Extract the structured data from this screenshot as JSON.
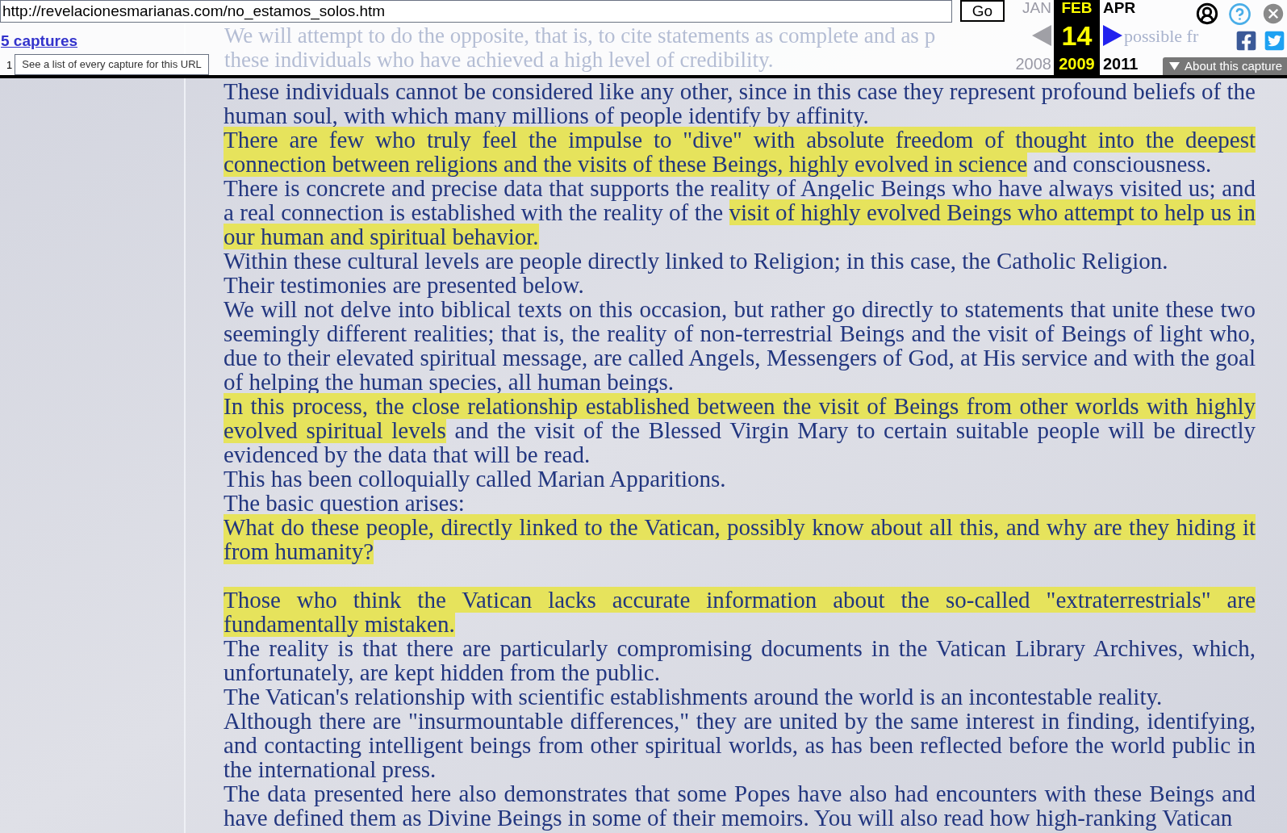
{
  "toolbar": {
    "url": "http://revelacionesmarianas.com/no_estamos_solos.htm",
    "go_button": "Go",
    "captures_link": "5 captures",
    "tooltip_prefix": "1",
    "tooltip": "See a list of every capture for this URL",
    "months": [
      {
        "month": "JAN",
        "year": "2008",
        "selected": false,
        "available": false
      },
      {
        "month": "FEB",
        "day": "14",
        "year": "2009",
        "selected": true
      },
      {
        "month": "APR",
        "year": "2011",
        "selected": false,
        "available": true
      }
    ],
    "about_button": "About this capture"
  },
  "page": {
    "faint_lines": [
      "We will attempt to do the opposite, that is, to cite statements as complete and as p",
      "these individuals who have achieved a high level of credibility."
    ],
    "faint_fragment": "possible fr",
    "paragraphs": [
      {
        "kind": "text",
        "segments": [
          {
            "text": "These individuals cannot be considered like any other, since in this case they represent profound beliefs of the human soul, with which many millions of people identify by affinity.",
            "highlighted": false
          }
        ]
      },
      {
        "kind": "text",
        "segments": [
          {
            "text": "There are few who truly feel the impulse to \"dive\" with absolute freedom of thought into the deepest connection between religions and the visits of these Beings, highly evolved in science",
            "highlighted": true
          },
          {
            "text": " and consciousness.",
            "highlighted": false
          }
        ]
      },
      {
        "kind": "text",
        "segments": [
          {
            "text": "There is concrete and precise data that supports the reality of Angelic Beings who have always visited us; and a real connection is established with the reality of the ",
            "highlighted": false
          },
          {
            "text": "visit of highly evolved Beings who attempt to help us in our human and spiritual behavior.",
            "highlighted": true
          }
        ]
      },
      {
        "kind": "text",
        "segments": [
          {
            "text": "Within these cultural levels are people directly linked to Religion; in this case, the Catholic Religion.",
            "highlighted": false
          }
        ]
      },
      {
        "kind": "text",
        "segments": [
          {
            "text": "Their testimonies are presented below.",
            "highlighted": false
          }
        ]
      },
      {
        "kind": "text",
        "segments": [
          {
            "text": "We will not delve into biblical texts on this occasion, but rather go directly to statements that unite these two seemingly different realities; that is, the reality of non-terrestrial Beings and the visit of Beings of light who, due to their elevated spiritual message, are called Angels, Messengers of God, at His service and with the goal of helping the human species, all human beings.",
            "highlighted": false
          }
        ]
      },
      {
        "kind": "text",
        "segments": [
          {
            "text": "In this process, the close relationship established between the visit of Beings from other worlds with highly evolved spiritual levels",
            "highlighted": true
          },
          {
            "text": " and the visit of the Blessed Virgin Mary to certain suitable people will be directly evidenced by the data that will be read.",
            "highlighted": false
          }
        ]
      },
      {
        "kind": "text",
        "segments": [
          {
            "text": "This has been colloquially called Marian Apparitions.",
            "highlighted": false
          }
        ]
      },
      {
        "kind": "text",
        "segments": [
          {
            "text": "The basic question arises:",
            "highlighted": false
          }
        ]
      },
      {
        "kind": "text",
        "segments": [
          {
            "text": "What do these people, directly linked to the Vatican, possibly know about all this, and why are they hiding it from humanity?",
            "highlighted": true
          }
        ]
      },
      {
        "kind": "gap"
      },
      {
        "kind": "text",
        "segments": [
          {
            "text": "Those who think the Vatican lacks accurate information about the so-called \"extraterrestrials\" are fundamentally mistaken.",
            "highlighted": true
          }
        ]
      },
      {
        "kind": "text",
        "segments": [
          {
            "text": "The reality is that there are particularly compromising documents in the Vatican Library Archives, which, unfortunately, are kept hidden from the public.",
            "highlighted": false
          }
        ]
      },
      {
        "kind": "text",
        "segments": [
          {
            "text": "The Vatican's relationship with scientific establishments around the world is an incontestable reality.",
            "highlighted": false
          }
        ]
      },
      {
        "kind": "text",
        "segments": [
          {
            "text": "Although there are \"insurmountable differences,\" they are united by the same interest in finding, identifying, and contacting intelligent beings from other spiritual worlds, as has been reflected before the world public in the international press.",
            "highlighted": false
          }
        ]
      },
      {
        "kind": "text",
        "segments": [
          {
            "text": "The data presented here also demonstrates that some Popes have also had encounters with these Beings and have defined them as Divine Beings in some of their memoirs. You will also read how high-ranking Vatican",
            "highlighted": false
          }
        ]
      }
    ]
  }
}
